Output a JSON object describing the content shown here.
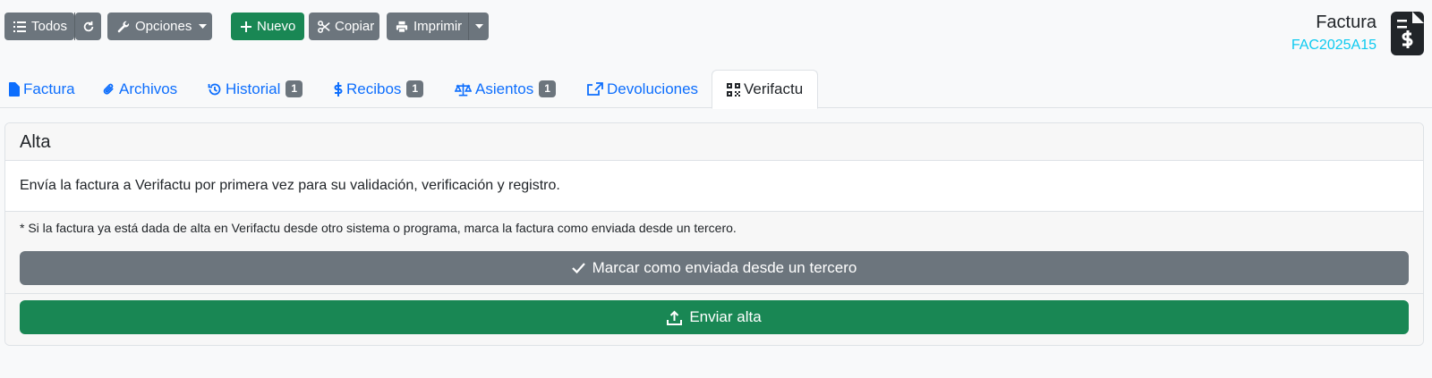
{
  "toolbar": {
    "todos_label": "Todos",
    "opciones_label": "Opciones",
    "nuevo_label": "Nuevo",
    "copiar_label": "Copiar",
    "imprimir_label": "Imprimir"
  },
  "document": {
    "type": "Factura",
    "code": "FAC2025A15"
  },
  "tabs": [
    {
      "label": "Factura",
      "icon": "file-icon"
    },
    {
      "label": "Archivos",
      "icon": "paperclip-icon"
    },
    {
      "label": "Historial",
      "icon": "history-icon",
      "badge": "1"
    },
    {
      "label": "Recibos",
      "icon": "dollar-icon",
      "badge": "1"
    },
    {
      "label": "Asientos",
      "icon": "scale-icon",
      "badge": "1"
    },
    {
      "label": "Devoluciones",
      "icon": "share-icon"
    },
    {
      "label": "Verifactu",
      "icon": "qrcode-icon",
      "active": true
    }
  ],
  "card": {
    "title": "Alta",
    "description": "Envía la factura a Verifactu por primera vez para su validación, verificación y registro.",
    "note": "* Si la factura ya está dada de alta en Verifactu desde otro sistema o programa, marca la factura como enviada desde un tercero.",
    "mark_button": "Marcar como enviada desde un tercero",
    "send_button": "Enviar alta"
  },
  "colors": {
    "primary": "#0d6efd",
    "secondary": "#6c757d",
    "success": "#198754",
    "info": "#0dcaf0"
  }
}
